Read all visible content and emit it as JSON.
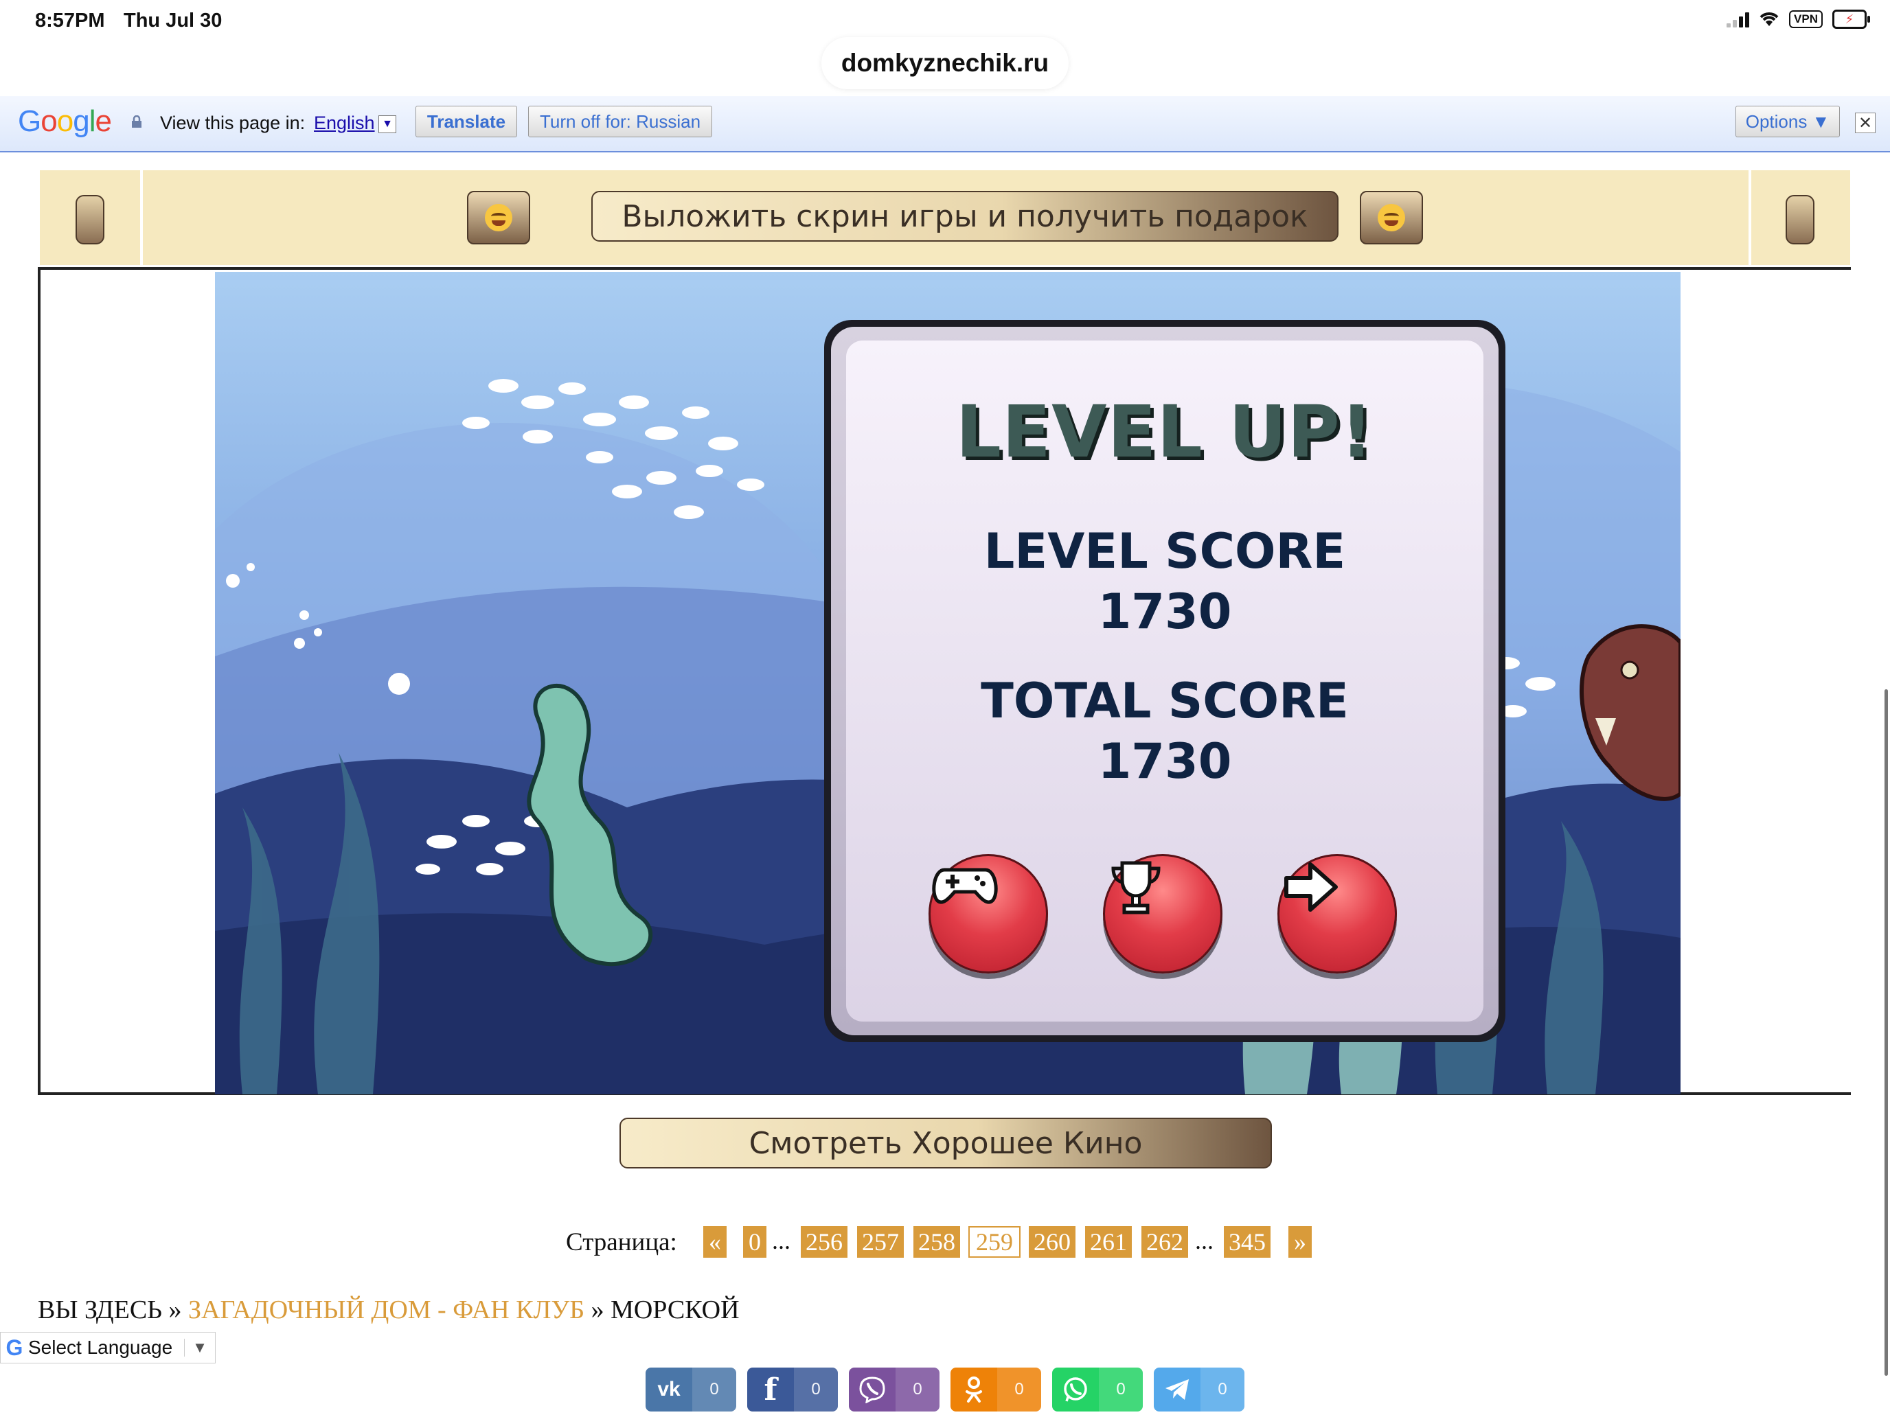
{
  "status_bar": {
    "time": "8:57PM",
    "date": "Thu Jul 30",
    "vpn": "VPN"
  },
  "browser": {
    "url": "domkyznechik.ru"
  },
  "translate_bar": {
    "logo": "Google",
    "prompt": "View this page in:",
    "language": "English",
    "translate_label": "Translate",
    "turn_off_label": "Turn off for: Russian",
    "options_label": "Options ▼",
    "close_label": "✕"
  },
  "banner": {
    "button_label": "Выложить скрин игры и получить подарок"
  },
  "game": {
    "title": "LEVEL UP!",
    "level_score_label": "LEVEL SCORE",
    "level_score": "1730",
    "total_score_label": "TOTAL SCORE",
    "total_score": "1730",
    "buttons": [
      "gamepad-icon",
      "trophy-icon",
      "arrow-right-icon"
    ]
  },
  "movie_button": {
    "label": "Смотреть Хорошее Кино"
  },
  "pagination": {
    "label": "Страница:",
    "prev": "«",
    "first": "0",
    "ellipsis": "...",
    "pages": [
      "256",
      "257",
      "258",
      "259",
      "260",
      "261",
      "262"
    ],
    "current": "259",
    "last": "345",
    "next": "»"
  },
  "breadcrumb": {
    "you_are_here": "ВЫ ЗДЕСЬ",
    "sep": "»",
    "link": "ЗАГАДОЧНЫЙ ДОМ - ФАН КЛУБ",
    "current": "МОРСКОЙ"
  },
  "language_select": {
    "label": "Select Language"
  },
  "share": [
    {
      "network": "vk",
      "icon": "vk-icon",
      "count": "0",
      "color": "#4a76a8"
    },
    {
      "network": "facebook",
      "icon": "facebook-icon",
      "count": "0",
      "color": "#3b5998"
    },
    {
      "network": "viber",
      "icon": "viber-icon",
      "count": "0",
      "color": "#7b519d"
    },
    {
      "network": "odnoklassniki",
      "icon": "odnoklassniki-icon",
      "count": "0",
      "color": "#ee8208"
    },
    {
      "network": "whatsapp",
      "icon": "whatsapp-icon",
      "count": "0",
      "color": "#25d366"
    },
    {
      "network": "telegram",
      "icon": "telegram-icon",
      "count": "0",
      "color": "#54a9eb"
    }
  ],
  "colors": {
    "accent_orange": "#d99b3a",
    "banner_bg": "#f6e9bf",
    "google_link": "#1a0dab"
  }
}
